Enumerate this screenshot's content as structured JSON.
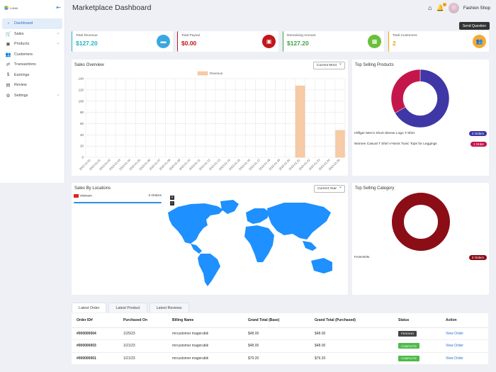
{
  "sidebar": {
    "logo": "LUMA",
    "items": [
      {
        "label": "Dashboard",
        "icon": "dashboard-icon",
        "glyph": "◔",
        "active": true,
        "chevron": false
      },
      {
        "label": "Sales",
        "icon": "cart-icon",
        "glyph": "🛒",
        "chevron": true
      },
      {
        "label": "Products",
        "icon": "box-icon",
        "glyph": "▣",
        "chevron": true
      },
      {
        "label": "Customers",
        "icon": "users-icon",
        "glyph": "👥",
        "chevron": false
      },
      {
        "label": "Transactions",
        "icon": "transfer-icon",
        "glyph": "⇄",
        "chevron": false
      },
      {
        "label": "Earnings",
        "icon": "dollar-icon",
        "glyph": "$",
        "chevron": false
      },
      {
        "label": "Review",
        "icon": "review-icon",
        "glyph": "▤",
        "chevron": false
      },
      {
        "label": "Settings",
        "icon": "gear-icon",
        "glyph": "⚙",
        "chevron": true
      }
    ]
  },
  "header": {
    "title": "Marketplace Dashboard",
    "shop_name": "Fashion Shop",
    "send_question": "Send Question"
  },
  "kpis": [
    {
      "label": "Total Revenue",
      "value": "$127.20",
      "color": "#1fb5c9",
      "bg": "#3ba7e0",
      "glyph": "▬"
    },
    {
      "label": "Total Payout",
      "value": "$0.00",
      "color": "#c0161c",
      "bg": "#c0161c",
      "glyph": "▣"
    },
    {
      "label": "Remaining Amount",
      "value": "$127.20",
      "color": "#43a047",
      "bg": "#6bbf3a",
      "glyph": "▦"
    },
    {
      "label": "Total Customers",
      "value": "2",
      "color": "#f5a300",
      "bg": "#f7a935",
      "glyph": "👥"
    }
  ],
  "sales_overview": {
    "title": "Sales Overview",
    "select": "Current Mont",
    "legend": "Revenue"
  },
  "chart_data": {
    "type": "bar",
    "title": "Sales Overview",
    "legend": "top-center",
    "series": [
      {
        "name": "Revenue",
        "color": "#f7cba6"
      }
    ],
    "categories": [
      "2022-12-31",
      "2023-01-01",
      "2023-01-02",
      "2023-01-03",
      "2023-01-04",
      "2023-01-05",
      "2023-01-06",
      "2023-01-07",
      "2023-01-08",
      "2023-01-09",
      "2023-01-10",
      "2023-01-11",
      "2023-01-12",
      "2023-01-13",
      "2023-01-14",
      "2023-01-15",
      "2023-01-16",
      "2023-01-17",
      "2023-01-18",
      "2023-01-19",
      "2023-01-20",
      "2023-01-21",
      "2023-01-22",
      "2023-01-23",
      "2023-01-24",
      "2023-01-25"
    ],
    "values": [
      0,
      0,
      0,
      0,
      0,
      0,
      0,
      0,
      0,
      0,
      0,
      0,
      0,
      0,
      0,
      0,
      0,
      0,
      0,
      0,
      0,
      127.2,
      0,
      0,
      0,
      48
    ],
    "yticks": [
      0,
      20,
      40,
      60,
      80,
      100,
      120,
      140
    ],
    "ylim": [
      0,
      140
    ],
    "grid": true
  },
  "top_products": {
    "title": "Top Selling Products",
    "items": [
      {
        "name": "Hilfiger Men's Short Sleeve Logo T-Shirt",
        "orders": "2 Orders",
        "value": 2,
        "color": "#3f37a6"
      },
      {
        "name": "Women Casual T Shirt V-Neck Tunic Tops for Leggings",
        "orders": "1 Order",
        "value": 1,
        "color": "#c4164b"
      }
    ]
  },
  "locations": {
    "title": "Sales By Locations",
    "select": "Current Year",
    "country": "Vietnam",
    "orders": "3 Orders",
    "zoom_in": "+",
    "zoom_out": "−"
  },
  "top_category": {
    "title": "Top Selling Category",
    "items": [
      {
        "name": "FASHION",
        "orders": "3 Orders",
        "value": 3,
        "color": "#8b0d16"
      }
    ]
  },
  "orders": {
    "tabs": [
      "Latest Order",
      "Latest Product",
      "Latest Reviews"
    ],
    "columns": [
      "Order ID#",
      "Purchased On",
      "Billing Name",
      "Grand Total (Base)",
      "Grand Total (Purchased)",
      "Status",
      "Action"
    ],
    "rows": [
      {
        "id": "#000000004",
        "date": "1/25/23",
        "name": "mrcustomer magerubik",
        "base": "$48.00",
        "purchased": "$48.00",
        "status": "PENDING",
        "status_color": "#444",
        "action": "View Order"
      },
      {
        "id": "#000000003",
        "date": "1/21/23",
        "name": "mrcustomer magerubik",
        "base": "$48.00",
        "purchased": "$48.00",
        "status": "COMPLETE",
        "status_color": "#4cbb4a",
        "action": "View Order"
      },
      {
        "id": "#000000001",
        "date": "1/21/23",
        "name": "mrcustomer magerubik",
        "base": "$79.20",
        "purchased": "$79.20",
        "status": "COMPLETE",
        "status_color": "#4cbb4a",
        "action": "View Order"
      }
    ]
  }
}
